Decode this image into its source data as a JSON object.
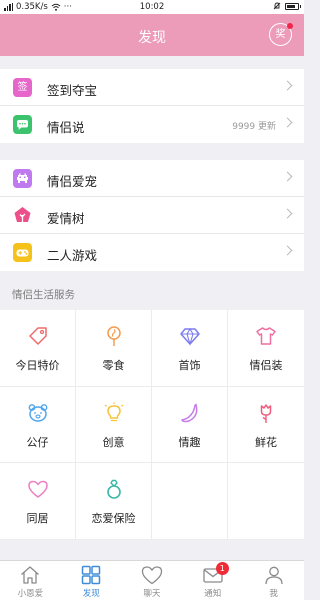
{
  "status_bar": {
    "signal_text": "0.35K/s",
    "dots": "···",
    "time": "10:02"
  },
  "header": {
    "title": "发现",
    "prize_label": "奖"
  },
  "group1": [
    {
      "icon_text": "签",
      "icon_color": "#e766c9",
      "label": "签到夺宝",
      "extra": ""
    },
    {
      "icon_text": "",
      "icon_color": "#3bc46d",
      "label": "情侣说",
      "extra": "9999 更新"
    }
  ],
  "group2": [
    {
      "icon_text": "",
      "icon_color": "#c07af0",
      "label": "情侣爱宠",
      "extra": ""
    },
    {
      "icon_text": "",
      "icon_color": "#ec4f8a",
      "label": "爱情树",
      "extra": ""
    },
    {
      "icon_text": "",
      "icon_color": "#f4c21a",
      "label": "二人游戏",
      "extra": ""
    }
  ],
  "services_title": "情侣生活服务",
  "services": [
    {
      "name": "今日特价",
      "icon": "price-tag-icon",
      "color": "#f06a6a"
    },
    {
      "name": "零食",
      "icon": "lollipop-icon",
      "color": "#f59a4c"
    },
    {
      "name": "首饰",
      "icon": "diamond-icon",
      "color": "#7c7cf0"
    },
    {
      "name": "情侣装",
      "icon": "tshirt-icon",
      "color": "#ee6fa0"
    },
    {
      "name": "公仔",
      "icon": "bear-icon",
      "color": "#4fa6ec"
    },
    {
      "name": "创意",
      "icon": "lightbulb-icon",
      "color": "#f3c33a"
    },
    {
      "name": "情趣",
      "icon": "banana-icon",
      "color": "#c57be8"
    },
    {
      "name": "鲜花",
      "icon": "flower-icon",
      "color": "#f05c7c"
    },
    {
      "name": "同居",
      "icon": "heart-icon",
      "color": "#ec7fc2"
    },
    {
      "name": "恋爱保险",
      "icon": "ring-icon",
      "color": "#3cb8a8"
    }
  ],
  "tabs": [
    {
      "label": "小恩爱",
      "icon": "house-icon",
      "active": false
    },
    {
      "label": "发现",
      "icon": "grid-icon",
      "active": true
    },
    {
      "label": "聊天",
      "icon": "heart-outline-icon",
      "active": false
    },
    {
      "label": "通知",
      "icon": "envelope-icon",
      "active": false,
      "badge": "1"
    },
    {
      "label": "我",
      "icon": "person-icon",
      "active": false
    }
  ]
}
